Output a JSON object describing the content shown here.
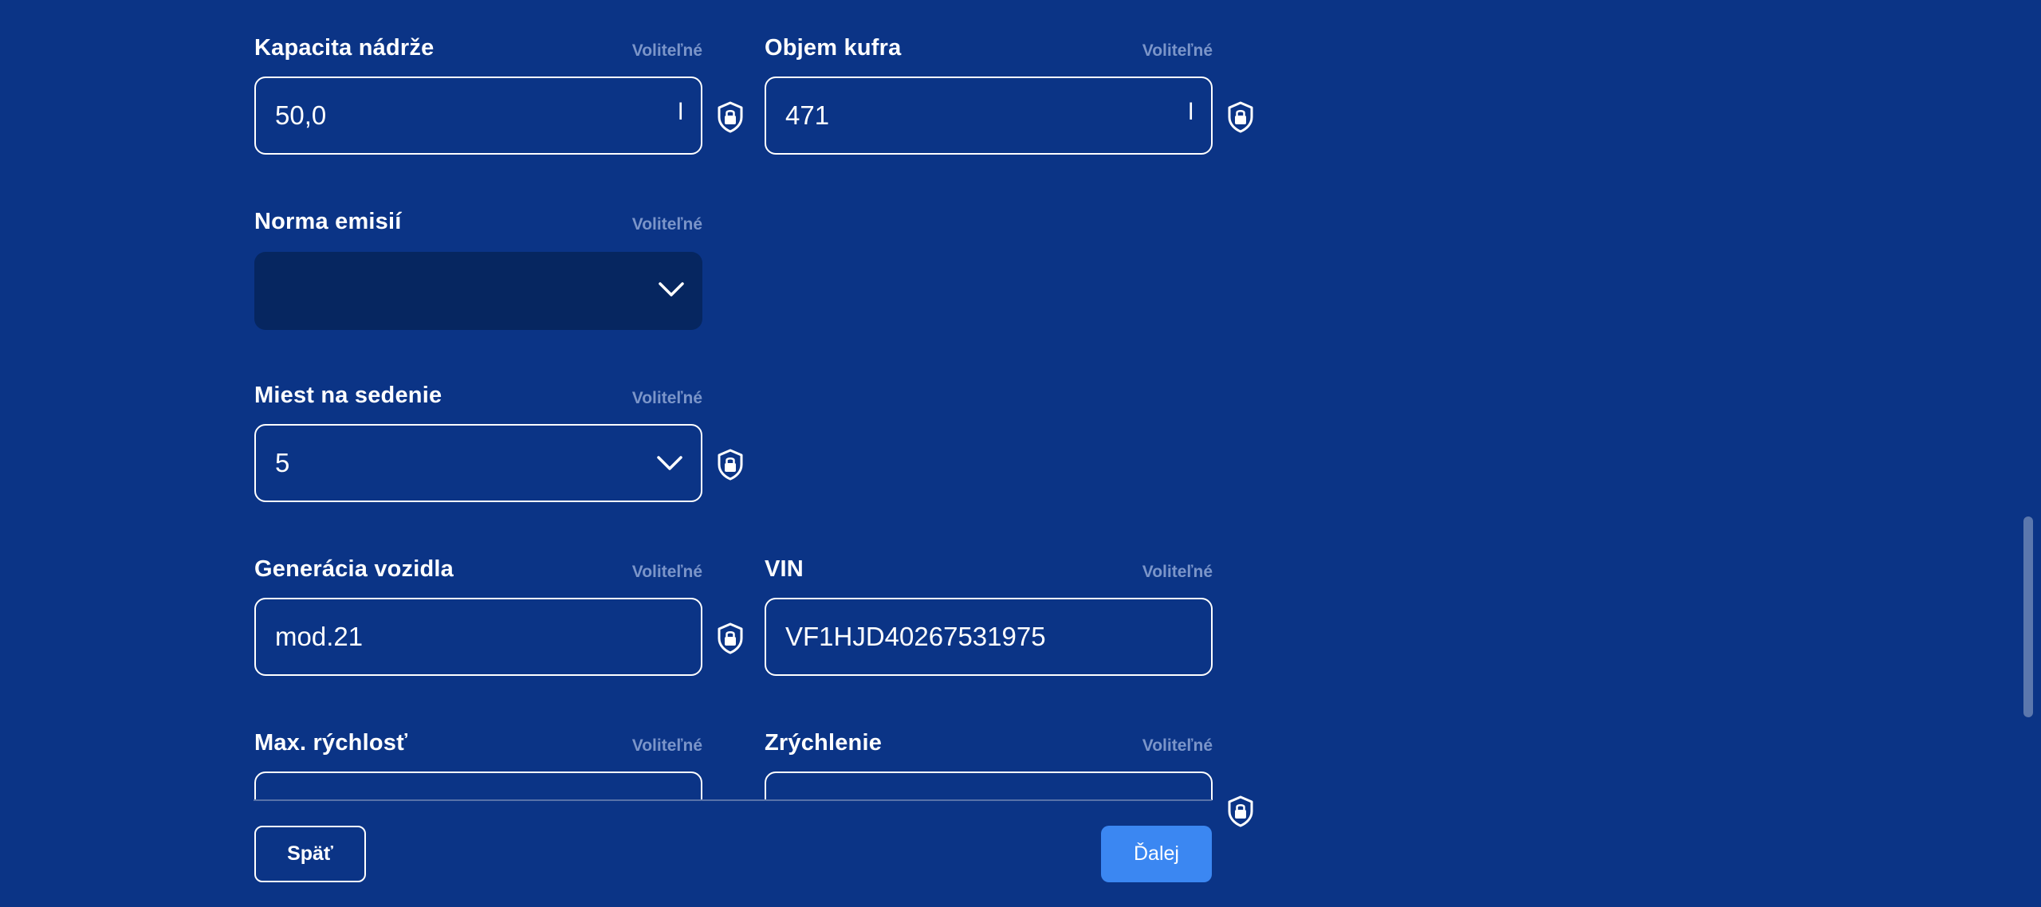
{
  "optional_label": "Voliteľné",
  "fields": {
    "tank": {
      "label": "Kapacita nádrže",
      "value": "50,0",
      "unit": "l"
    },
    "trunk": {
      "label": "Objem kufra",
      "value": "471",
      "unit": "l"
    },
    "emission": {
      "label": "Norma emisií",
      "value": ""
    },
    "seats": {
      "label": "Miest na sedenie",
      "value": "5"
    },
    "generation": {
      "label": "Generácia vozidla",
      "value": "mod.21"
    },
    "vin": {
      "label": "VIN",
      "value": "VF1HJD40267531975"
    },
    "max_speed": {
      "label": "Max. rýchlosť",
      "value": ""
    },
    "acceleration": {
      "label": "Zrýchlenie",
      "value": ""
    }
  },
  "buttons": {
    "back": "Späť",
    "next": "Ďalej"
  },
  "icons": {
    "lock": "shield-lock-icon",
    "chevron": "chevron-down-icon"
  },
  "colors": {
    "background": "#0b3486",
    "dark_field": "#062660",
    "primary": "#3b87f2",
    "muted": "#7b95c9"
  }
}
